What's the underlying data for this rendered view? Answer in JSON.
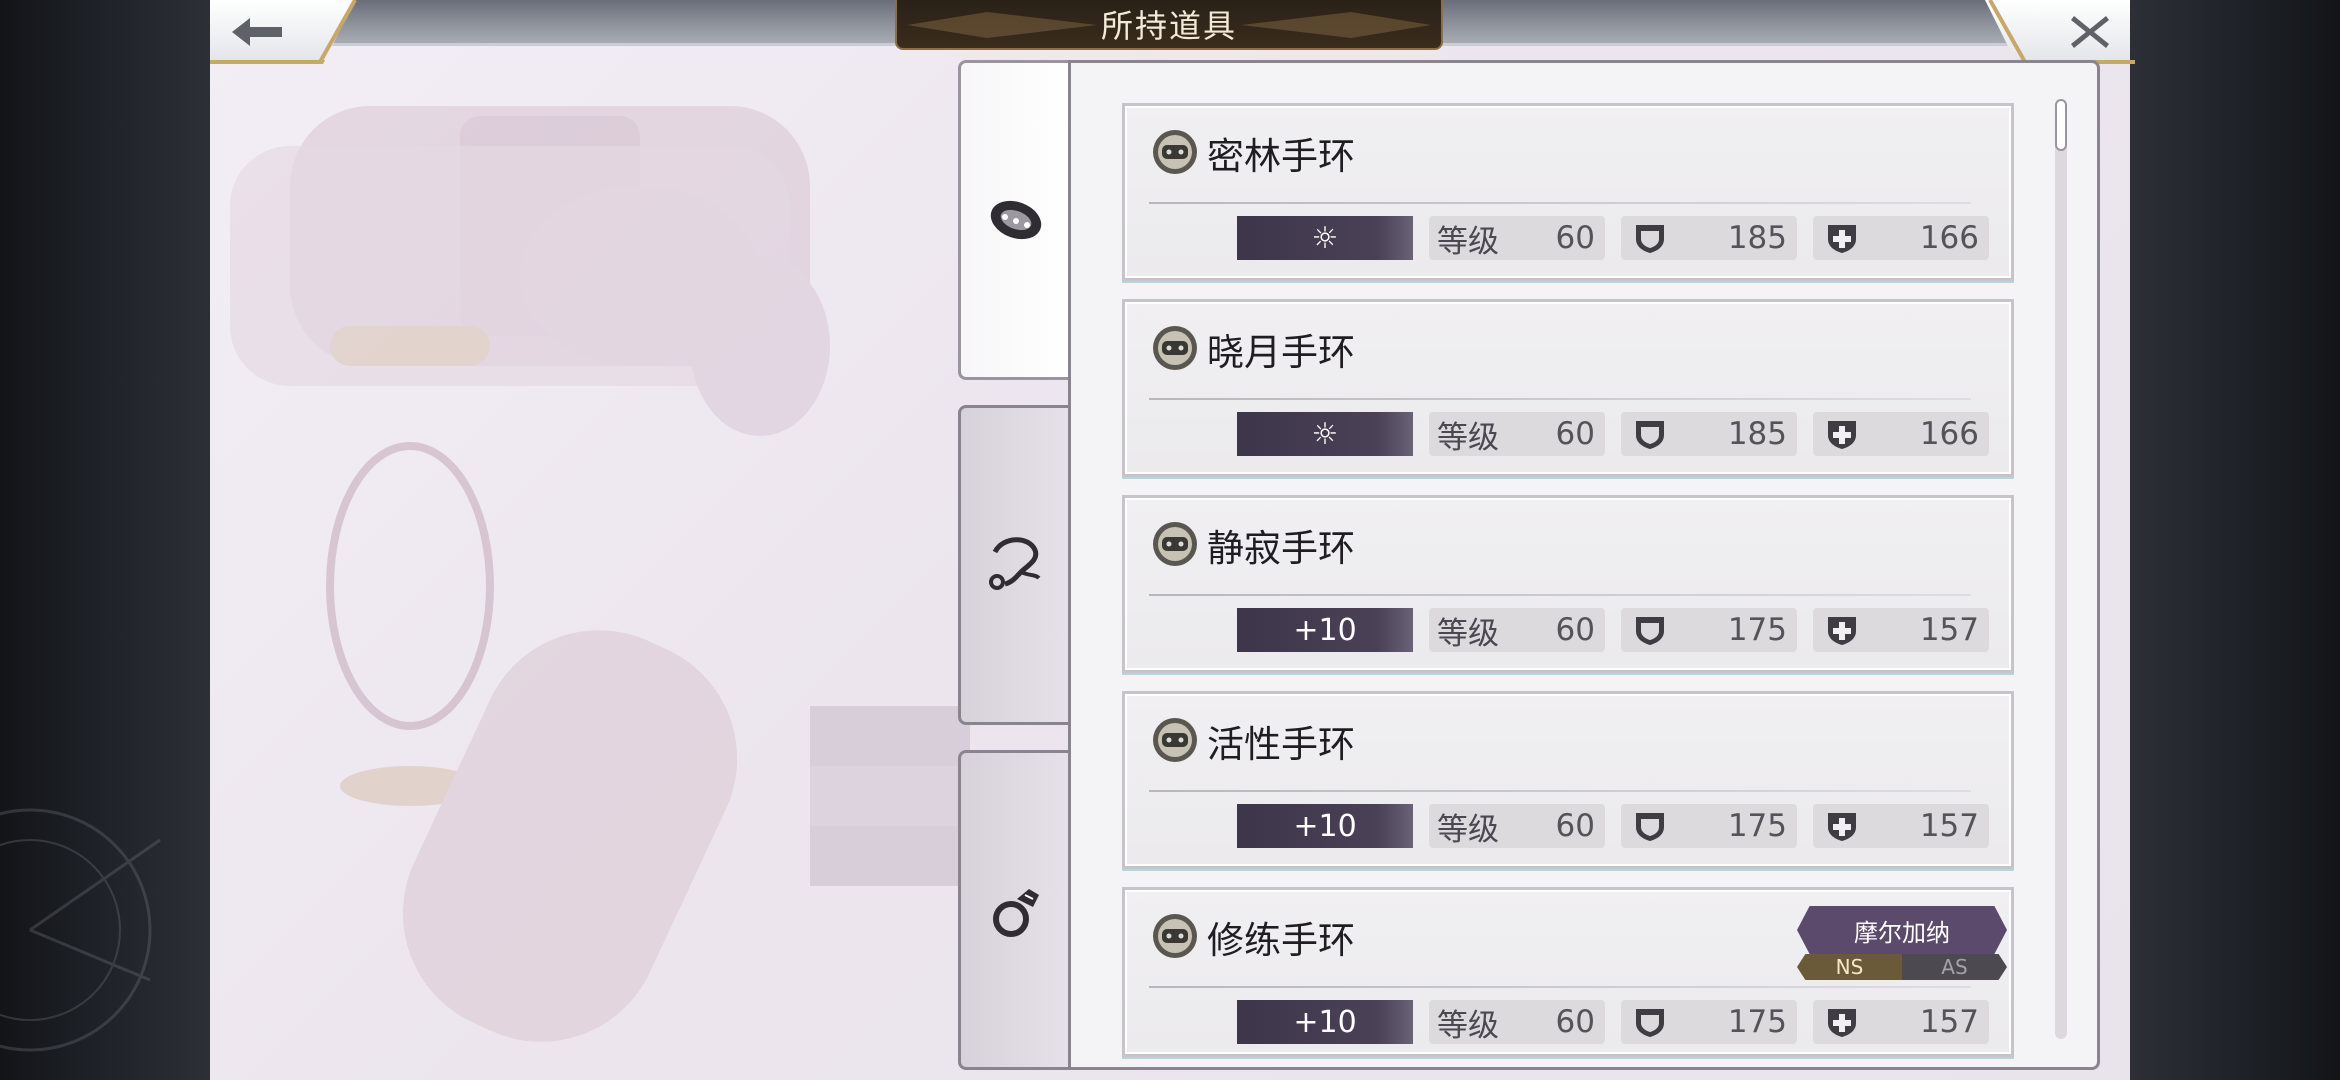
{
  "title": "所持道具",
  "scrollbar": {
    "position_fraction": 0.0
  },
  "tabs": [
    {
      "icon": "bracelet-icon",
      "active": true
    },
    {
      "icon": "necklace-icon",
      "active": false
    },
    {
      "icon": "ring-icon",
      "active": false
    }
  ],
  "stat_labels": {
    "level": "等级"
  },
  "items": [
    {
      "name": "密林手环",
      "refine": "☼",
      "level": "60",
      "def": "185",
      "mdef": "166"
    },
    {
      "name": "晓月手环",
      "refine": "☼",
      "level": "60",
      "def": "185",
      "mdef": "166"
    },
    {
      "name": "静寂手环",
      "refine": "+10",
      "level": "60",
      "def": "175",
      "mdef": "157"
    },
    {
      "name": "活性手环",
      "refine": "+10",
      "level": "60",
      "def": "175",
      "mdef": "157"
    },
    {
      "name": "修练手环",
      "refine": "+10",
      "level": "60",
      "def": "175",
      "mdef": "157",
      "character": "摩尔加纳",
      "style_ns": "NS",
      "style_as": "AS"
    }
  ],
  "colors": {
    "refine_bg": "#3d3549",
    "badge": "#5c4a6d",
    "gold": "#c7a76a"
  }
}
